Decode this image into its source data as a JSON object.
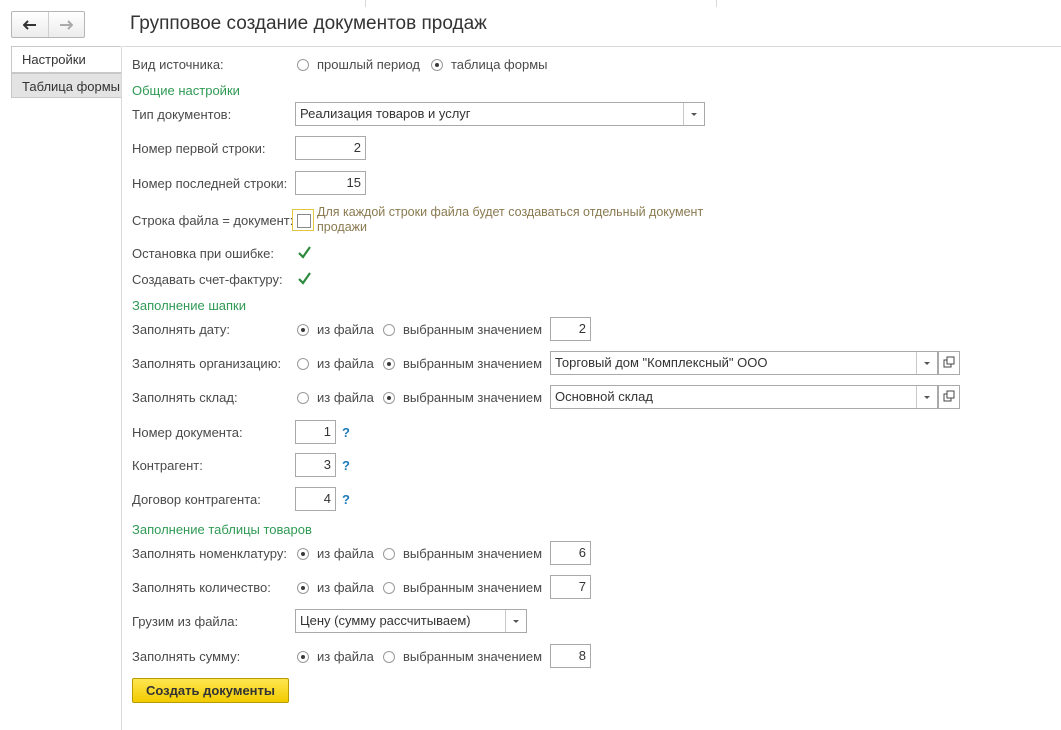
{
  "window": {
    "title": "Групповое создание документов продаж"
  },
  "nav": {
    "back": "back",
    "forward": "forward"
  },
  "tabs": [
    {
      "label": "Настройки"
    },
    {
      "label": "Таблица формы"
    }
  ],
  "source": {
    "label": "Вид источника:",
    "opt1": "прошлый период",
    "opt2": "таблица формы",
    "selected": "таблица формы"
  },
  "sections": {
    "general": "Общие настройки",
    "header": "Заполнение шапки",
    "table": "Заполнение таблицы товаров"
  },
  "doc_type": {
    "label": "Тип документов:",
    "value": "Реализация товаров и услуг"
  },
  "first_row": {
    "label": "Номер первой строки:",
    "value": "2"
  },
  "last_row": {
    "label": "Номер последней строки:",
    "value": "15"
  },
  "row_is_doc": {
    "label": "Строка файла = документ:",
    "checked": false,
    "hint": "Для каждой строки файла будет создаваться отдельный документ продажи"
  },
  "stop_on_error": {
    "label": "Остановка при ошибке:",
    "checked": true
  },
  "create_invoice": {
    "label": "Создавать счет-фактуру:",
    "checked": true
  },
  "opt": {
    "from_file": "из файла",
    "selected_value": "выбранным значением"
  },
  "fill_date": {
    "label": "Заполнять дату:",
    "mode": "из файла",
    "value": "2"
  },
  "fill_org": {
    "label": "Заполнять организацию:",
    "mode": "выбранным значением",
    "value": "Торговый дом \"Комплексный\" ООО"
  },
  "fill_warehouse": {
    "label": "Заполнять склад:",
    "mode": "выбранным значением",
    "value": "Основной склад"
  },
  "doc_number": {
    "label": "Номер документа:",
    "value": "1",
    "help": "?"
  },
  "counterparty": {
    "label": "Контрагент:",
    "value": "3",
    "help": "?"
  },
  "contract": {
    "label": "Договор контрагента:",
    "value": "4",
    "help": "?"
  },
  "fill_item": {
    "label": "Заполнять номенклатуру:",
    "mode": "из файла",
    "value": "6"
  },
  "fill_qty": {
    "label": "Заполнять количество:",
    "mode": "из файла",
    "value": "7"
  },
  "load_from_file": {
    "label": "Грузим из файла:",
    "value": "Цену (сумму рассчитываем)"
  },
  "fill_sum": {
    "label": "Заполнять сумму:",
    "mode": "из файла",
    "value": "8"
  },
  "submit": {
    "label": "Создать документы"
  },
  "colors": {
    "section": "#2f9a54",
    "submit": "#f1cb00",
    "help": "#1f7ab8"
  }
}
